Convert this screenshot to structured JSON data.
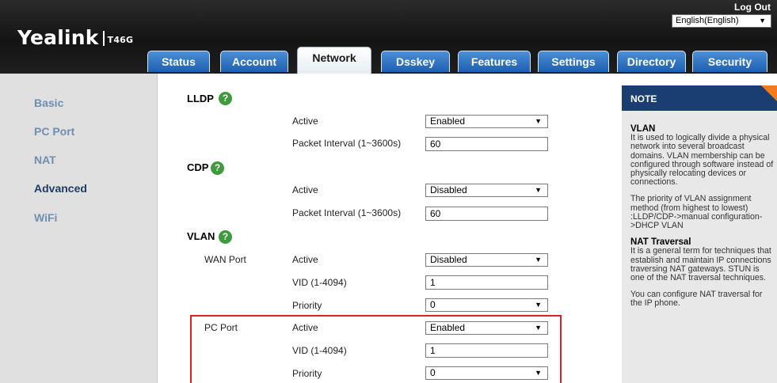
{
  "header": {
    "brand": "Yealink",
    "model": "T46G",
    "logout": "Log Out",
    "language": "English(English)"
  },
  "tabs": [
    {
      "label": "Status"
    },
    {
      "label": "Account"
    },
    {
      "label": "Network"
    },
    {
      "label": "Dsskey"
    },
    {
      "label": "Features"
    },
    {
      "label": "Settings"
    },
    {
      "label": "Directory"
    },
    {
      "label": "Security"
    }
  ],
  "active_tab": "Network",
  "sidebar": {
    "items": [
      {
        "label": "Basic"
      },
      {
        "label": "PC Port"
      },
      {
        "label": "NAT"
      },
      {
        "label": "Advanced"
      },
      {
        "label": "WiFi"
      }
    ],
    "active": "Advanced"
  },
  "help_glyph": "?",
  "select_arrow": "▼",
  "lldp": {
    "title": "LLDP",
    "active_label": "Active",
    "active_value": "Enabled",
    "interval_label": "Packet Interval (1~3600s)",
    "interval_value": "60"
  },
  "cdp": {
    "title": "CDP",
    "active_label": "Active",
    "active_value": "Disabled",
    "interval_label": "Packet Interval (1~3600s)",
    "interval_value": "60"
  },
  "vlan": {
    "title": "VLAN",
    "wan": {
      "label": "WAN Port",
      "active_label": "Active",
      "active_value": "Disabled",
      "vid_label": "VID (1-4094)",
      "vid_value": "1",
      "priority_label": "Priority",
      "priority_value": "0"
    },
    "pc": {
      "label": "PC Port",
      "active_label": "Active",
      "active_value": "Enabled",
      "vid_label": "VID (1-4094)",
      "vid_value": "1",
      "priority_label": "Priority",
      "priority_value": "0"
    }
  },
  "note": {
    "title": "NOTE",
    "vlan_heading": "VLAN",
    "vlan_text": "It is used to logically divide a physical network into several broadcast domains. VLAN membership can be configured through software instead of physically relocating devices or connections.",
    "vlan_priority_text": "The priority of VLAN assignment method (from highest to lowest) :LLDP/CDP->manual configuration->DHCP VLAN",
    "nat_heading": "NAT Traversal",
    "nat_text": "It is a general term for techniques that establish and maintain IP connections traversing NAT gateways. STUN is one of the NAT traversal techniques.",
    "nat_config_text": "You can configure NAT traversal for the IP phone."
  },
  "colors": {
    "tab_blue": "#2a6ec0",
    "note_header": "#1a3e72",
    "note_accent": "#f07c1c",
    "highlight": "#e02020",
    "help_green": "#3d9a3d"
  }
}
